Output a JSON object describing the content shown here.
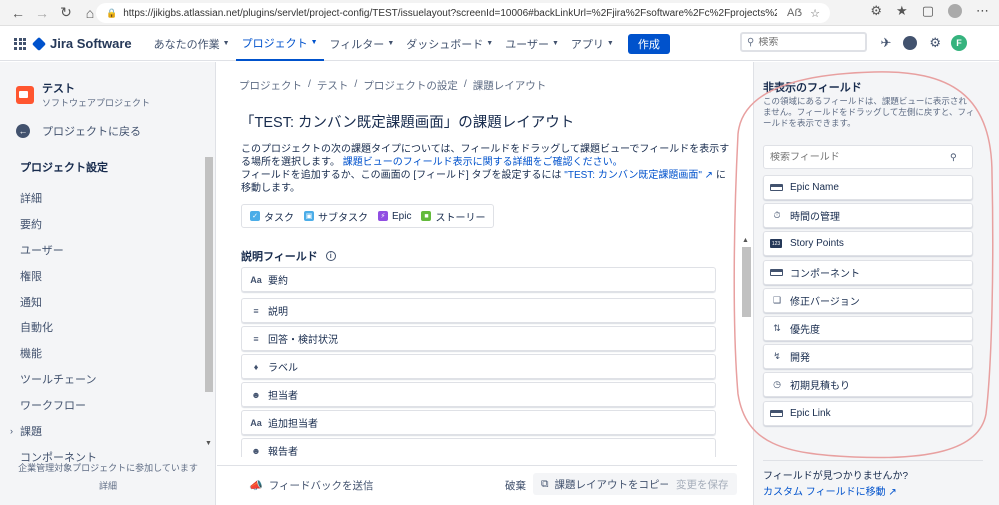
{
  "browser": {
    "url": "https://jikigbs.atlassian.net/plugins/servlet/project-config/TEST/issuelayout?screenId=10006#backLinkUrl=%2Fjira%2Fsoftware%2Fc%2Fprojects%2FTEST%2Fboards..."
  },
  "topnav": {
    "product": "Jira Software",
    "items": [
      {
        "label": "あなたの作業"
      },
      {
        "label": "プロジェクト"
      },
      {
        "label": "フィルター"
      },
      {
        "label": "ダッシュボード"
      },
      {
        "label": "ユーザー"
      },
      {
        "label": "アプリ"
      }
    ],
    "create_label": "作成",
    "search_placeholder": "検索",
    "user_initial": "F"
  },
  "sidebar": {
    "project_name": "テスト",
    "project_type": "ソフトウェアプロジェクト",
    "back_label": "プロジェクトに戻る",
    "settings_title": "プロジェクト設定",
    "items": [
      {
        "label": "詳細"
      },
      {
        "label": "要約"
      },
      {
        "label": "ユーザー"
      },
      {
        "label": "権限"
      },
      {
        "label": "通知"
      },
      {
        "label": "自動化"
      },
      {
        "label": "機能"
      },
      {
        "label": "ツールチェーン"
      },
      {
        "label": "ワークフロー"
      },
      {
        "label": "課題"
      },
      {
        "label": "コンポーネント"
      }
    ],
    "footer_line1": "企業管理対象プロジェクトに参加しています",
    "footer_line2": "詳細"
  },
  "main": {
    "breadcrumb": [
      "プロジェクト",
      "テスト",
      "プロジェクトの設定",
      "課題レイアウト"
    ],
    "title": "「TEST: カンバン既定課題画面」の課題レイアウト",
    "desc_part1": "このプロジェクトの次の課題タイプについては、フィールドをドラッグして課題ビューでフィールドを表示する場所を選択します。",
    "desc_link1": "課題ビューのフィールド表示に関する詳細をご確認ください。",
    "desc_part2": "フィールドを追加するか、この画面の [フィールド] タブを設定するには",
    "desc_link2": "\"TEST: カンバン既定課題画面\"",
    "desc_part3": " に移動します。",
    "issue_types": [
      {
        "label": "タスク",
        "color": "#4bade8"
      },
      {
        "label": "サブタスク",
        "color": "#4bade8"
      },
      {
        "label": "Epic",
        "color": "#904ee2"
      },
      {
        "label": "ストーリー",
        "color": "#63ba3c"
      }
    ],
    "section_title": "説明フィールド",
    "fields": [
      {
        "label": "要約",
        "icon": "text-icon"
      },
      {
        "label": "説明",
        "icon": "paragraph-icon"
      },
      {
        "label": "回答・検討状況",
        "icon": "paragraph-icon"
      },
      {
        "label": "ラベル",
        "icon": "tag-icon"
      },
      {
        "label": "担当者",
        "icon": "user-icon"
      },
      {
        "label": "追加担当者",
        "icon": "text-icon"
      },
      {
        "label": "報告者",
        "icon": "user-icon"
      }
    ],
    "feedback_label": "フィードバックを送信",
    "discard_label": "破棄",
    "copy_label": "課題レイアウトをコピー",
    "save_label": "変更を保存"
  },
  "right_panel": {
    "title": "非表示のフィールド",
    "description": "この領域にあるフィールドは、課題ビューに表示されません。フィールドをドラッグして左側に戻すと、フィールドを表示できます。",
    "search_placeholder": "検索フィールド",
    "fields": [
      {
        "label": "Epic Name",
        "icon": "epic-name-icon"
      },
      {
        "label": "時間の管理",
        "icon": "stopwatch-icon"
      },
      {
        "label": "Story Points",
        "icon": "number-icon"
      },
      {
        "label": "コンポーネント",
        "icon": "component-icon"
      },
      {
        "label": "修正バージョン",
        "icon": "version-icon"
      },
      {
        "label": "優先度",
        "icon": "priority-icon"
      },
      {
        "label": "開発",
        "icon": "branch-icon"
      },
      {
        "label": "初期見積もり",
        "icon": "clock-icon"
      },
      {
        "label": "Epic Link",
        "icon": "epic-link-icon"
      }
    ],
    "footer_question": "フィールドが見つかりませんか?",
    "footer_link": "カスタム フィールドに移動"
  },
  "colors": {
    "brand_blue": "#0052cc",
    "annotation": "#e8a0a0"
  }
}
